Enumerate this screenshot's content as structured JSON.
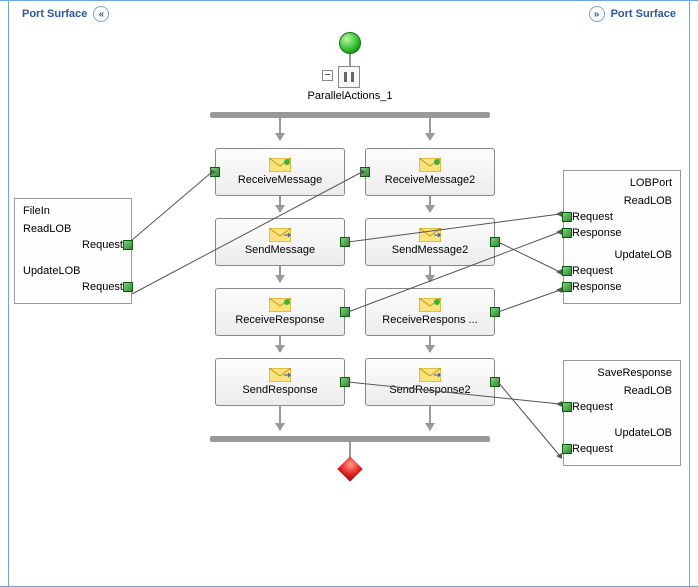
{
  "left_header": {
    "label": "Port Surface"
  },
  "right_header": {
    "label": "Port Surface"
  },
  "parallel": {
    "label": "ParallelActions_1"
  },
  "left_port": {
    "title": "FileIn",
    "ops": [
      {
        "name": "ReadLOB",
        "msgs": [
          {
            "label": "Request"
          }
        ]
      },
      {
        "name": "UpdateLOB",
        "msgs": [
          {
            "label": "Request"
          }
        ]
      }
    ]
  },
  "right_port_top": {
    "title": "LOBPort",
    "ops": [
      {
        "name": "ReadLOB",
        "msgs": [
          {
            "label": "Request"
          },
          {
            "label": "Response"
          }
        ]
      },
      {
        "name": "UpdateLOB",
        "msgs": [
          {
            "label": "Request"
          },
          {
            "label": "Response"
          }
        ]
      }
    ]
  },
  "right_port_bottom": {
    "title": "SaveResponse",
    "ops": [
      {
        "name": "ReadLOB",
        "msgs": [
          {
            "label": "Request"
          }
        ]
      },
      {
        "name": "UpdateLOB",
        "msgs": [
          {
            "label": "Request"
          }
        ]
      }
    ]
  },
  "shapes": {
    "col1": [
      {
        "label": "ReceiveMessage"
      },
      {
        "label": "SendMessage"
      },
      {
        "label": "ReceiveResponse"
      },
      {
        "label": "SendResponse"
      }
    ],
    "col2": [
      {
        "label": "ReceiveMessage2"
      },
      {
        "label": "SendMessage2"
      },
      {
        "label": "ReceiveRespons ..."
      },
      {
        "label": "SendResponse2"
      }
    ]
  },
  "colors": {
    "accent": "#2a58a5",
    "connector": "#2e8b2e"
  }
}
